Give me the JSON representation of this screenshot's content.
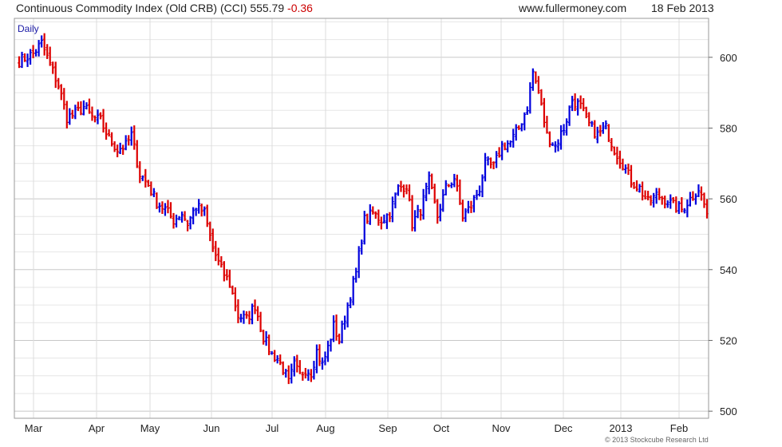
{
  "header": {
    "index_name": "Continuous Commodity Index (Old CRB) (CCI)",
    "last": "555.79",
    "change": "-0.36",
    "site": "www.fullermoney.com",
    "date": "18 Feb 2013"
  },
  "copyright": "© 2013 Stockcube Research Ltd",
  "colors": {
    "up": "#0000dd",
    "down": "#dd0000",
    "grid": "#d9d9d9",
    "frame": "#9a9a9a",
    "period": "#1a1aa6"
  },
  "chart_data": {
    "type": "ohlc",
    "title": "Continuous Commodity Index (Old CRB) (CCI)",
    "period_label": "Daily",
    "y_axis": {
      "side": "right",
      "ylim": [
        498,
        611
      ],
      "ticks": [
        500,
        520,
        540,
        560,
        580,
        600
      ],
      "minor_step": 5
    },
    "x_axis": {
      "labels": [
        "Mar",
        "Apr",
        "May",
        "Jun",
        "Jul",
        "Aug",
        "Sep",
        "Oct",
        "Nov",
        "Dec",
        "2013",
        "Feb"
      ]
    },
    "grid": true,
    "series_anchors": {
      "description": "closing levels at approx. trading-day index (0 = first bar, ~245 bars total)",
      "points": [
        [
          0,
          599
        ],
        [
          5,
          601
        ],
        [
          8,
          604
        ],
        [
          10,
          600
        ],
        [
          14,
          592
        ],
        [
          17,
          583
        ],
        [
          20,
          584
        ],
        [
          23,
          586
        ],
        [
          26,
          583
        ],
        [
          29,
          582
        ],
        [
          32,
          577
        ],
        [
          35,
          574
        ],
        [
          38,
          575
        ],
        [
          40,
          578
        ],
        [
          43,
          567
        ],
        [
          46,
          564
        ],
        [
          49,
          559
        ],
        [
          52,
          557
        ],
        [
          55,
          554
        ],
        [
          58,
          556
        ],
        [
          60,
          553
        ],
        [
          63,
          558
        ],
        [
          66,
          556
        ],
        [
          69,
          546
        ],
        [
          72,
          540
        ],
        [
          75,
          536
        ],
        [
          78,
          527
        ],
        [
          81,
          526
        ],
        [
          84,
          530
        ],
        [
          87,
          521
        ],
        [
          90,
          516
        ],
        [
          92,
          515
        ],
        [
          94,
          512
        ],
        [
          96,
          508
        ],
        [
          98,
          513
        ],
        [
          100,
          510
        ],
        [
          102,
          512
        ],
        [
          104,
          511
        ],
        [
          106,
          517
        ],
        [
          108,
          513
        ],
        [
          110,
          518
        ],
        [
          112,
          524
        ],
        [
          114,
          520
        ],
        [
          117,
          530
        ],
        [
          120,
          539
        ],
        [
          123,
          554
        ],
        [
          126,
          556
        ],
        [
          129,
          554
        ],
        [
          132,
          556
        ],
        [
          135,
          563
        ],
        [
          138,
          564
        ],
        [
          140,
          553
        ],
        [
          143,
          557
        ],
        [
          146,
          565
        ],
        [
          149,
          555
        ],
        [
          152,
          563
        ],
        [
          155,
          566
        ],
        [
          158,
          555
        ],
        [
          161,
          558
        ],
        [
          164,
          563
        ],
        [
          166,
          570
        ],
        [
          169,
          569
        ],
        [
          172,
          575
        ],
        [
          175,
          576
        ],
        [
          178,
          580
        ],
        [
          181,
          586
        ],
        [
          183,
          596
        ],
        [
          185,
          590
        ],
        [
          188,
          578
        ],
        [
          191,
          575
        ],
        [
          194,
          580
        ],
        [
          197,
          588
        ],
        [
          200,
          586
        ],
        [
          203,
          581
        ],
        [
          206,
          578
        ],
        [
          209,
          580
        ],
        [
          212,
          574
        ],
        [
          215,
          570
        ],
        [
          218,
          565
        ],
        [
          221,
          563
        ],
        [
          224,
          559
        ],
        [
          227,
          561
        ],
        [
          230,
          560
        ],
        [
          233,
          558
        ],
        [
          236,
          557
        ],
        [
          239,
          560
        ],
        [
          242,
          563
        ],
        [
          245,
          556
        ]
      ]
    },
    "last_close": 555.79
  }
}
